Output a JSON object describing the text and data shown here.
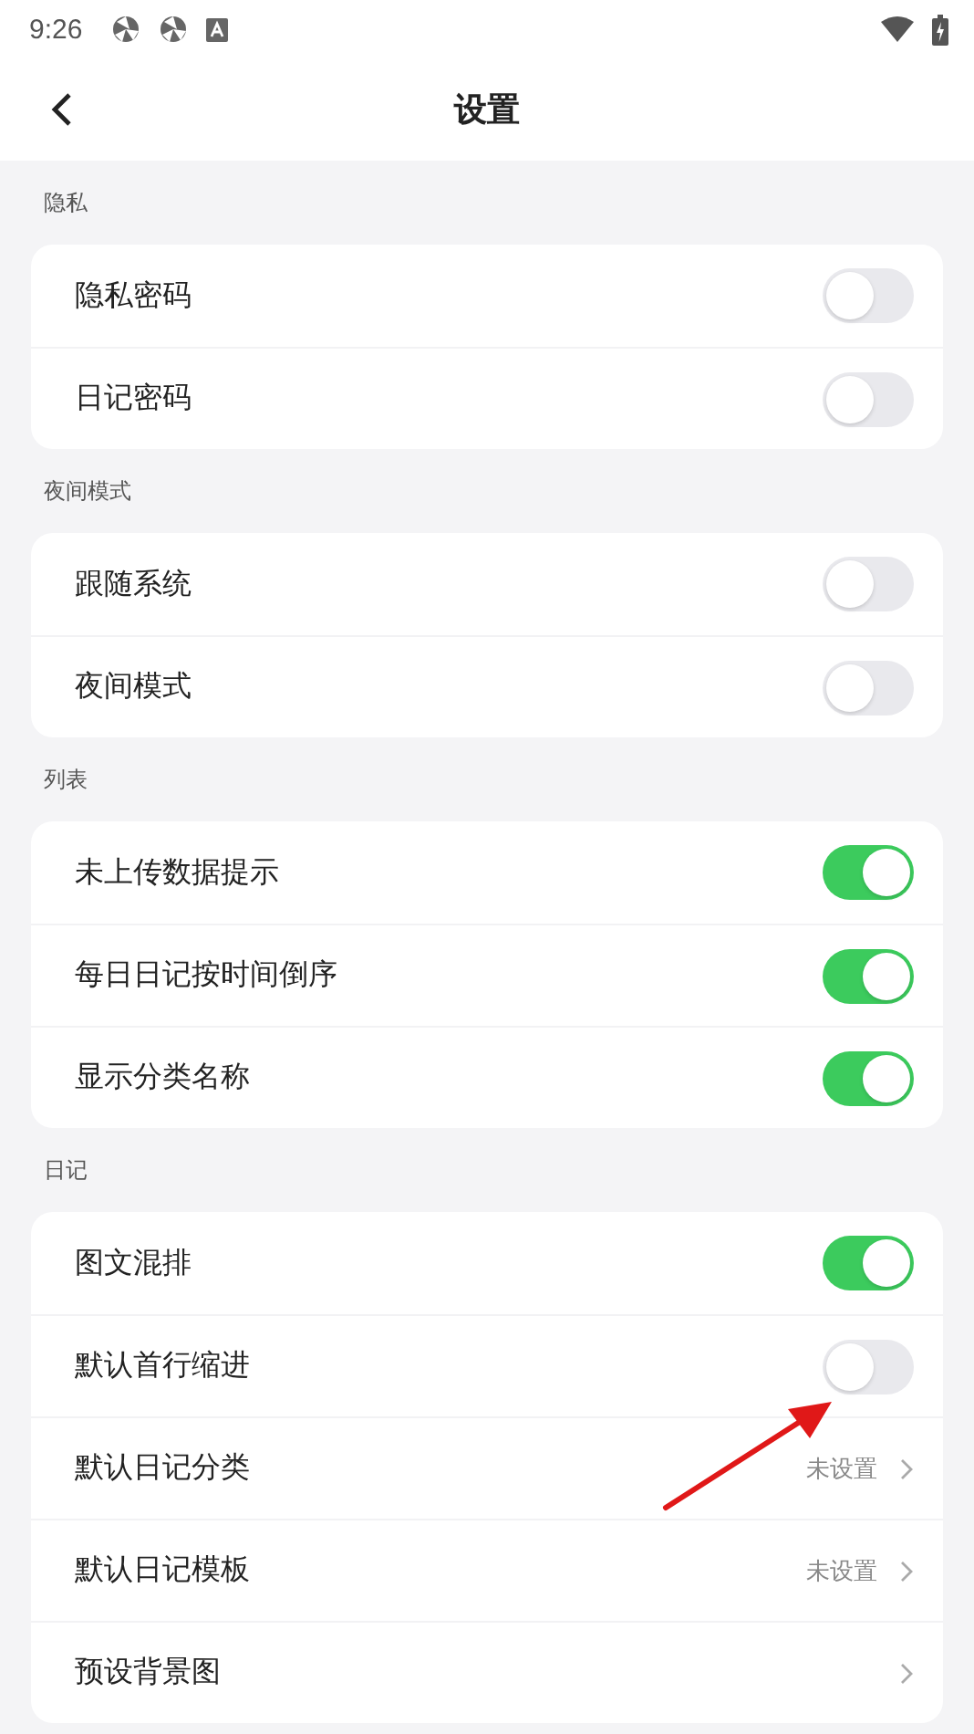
{
  "status_bar": {
    "time": "9:26"
  },
  "header": {
    "title": "设置"
  },
  "sections": [
    {
      "title": "隐私",
      "rows": [
        {
          "kind": "toggle",
          "label": "隐私密码",
          "on": false
        },
        {
          "kind": "toggle",
          "label": "日记密码",
          "on": false
        }
      ]
    },
    {
      "title": "夜间模式",
      "rows": [
        {
          "kind": "toggle",
          "label": "跟随系统",
          "on": false
        },
        {
          "kind": "toggle",
          "label": "夜间模式",
          "on": false
        }
      ]
    },
    {
      "title": "列表",
      "rows": [
        {
          "kind": "toggle",
          "label": "未上传数据提示",
          "on": true
        },
        {
          "kind": "toggle",
          "label": "每日日记按时间倒序",
          "on": true
        },
        {
          "kind": "toggle",
          "label": "显示分类名称",
          "on": true
        }
      ]
    },
    {
      "title": "日记",
      "rows": [
        {
          "kind": "toggle",
          "label": "图文混排",
          "on": true
        },
        {
          "kind": "toggle",
          "label": "默认首行缩进",
          "on": false
        },
        {
          "kind": "link",
          "label": "默认日记分类",
          "value": "未设置"
        },
        {
          "kind": "link",
          "label": "默认日记模板",
          "value": "未设置"
        },
        {
          "kind": "link",
          "label": "预设背景图"
        }
      ]
    }
  ]
}
